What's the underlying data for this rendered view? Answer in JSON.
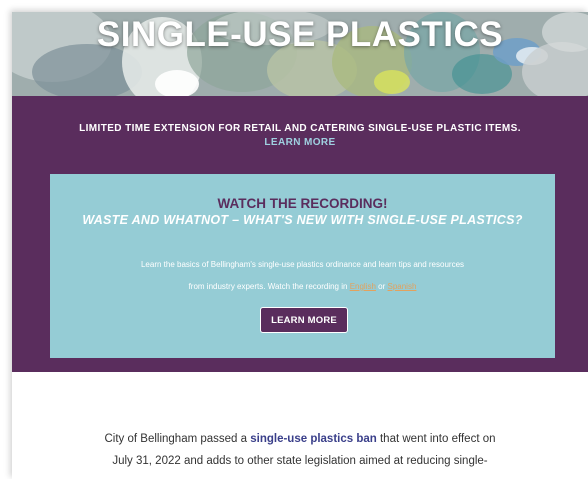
{
  "hero": {
    "title": "SINGLE-USE PLASTICS"
  },
  "notice": {
    "text": "LIMITED TIME EXTENSION FOR RETAIL AND CATERING SINGLE-USE PLASTIC ITEMS.",
    "link_label": "LEARN MORE"
  },
  "card": {
    "heading": "WATCH THE RECORDING!",
    "subheading": "WASTE AND WHATNOT – WHAT'S NEW WITH SINGLE-USE PLASTICS?",
    "body_line1": "Learn the basics of Bellingham's single-use plastics ordinance and learn tips and resources",
    "body_line2_prefix": "from industry experts.  Watch the recording in ",
    "english_link": "English",
    "or_text": " or ",
    "spanish_link": "Spanish",
    "button_label": "LEARN MORE"
  },
  "intro": {
    "line1_prefix": "City of Bellingham passed a ",
    "ban_link": "single-use plastics ban",
    "line1_suffix": " that went into effect on",
    "line2": "July 31, 2022 and adds to other state legislation aimed at reducing single-"
  },
  "colors": {
    "brand_purple": "#5a2d5d",
    "card_teal": "#95ccd5",
    "link_light_blue": "#9fd0e0",
    "link_orange": "#e2a25e",
    "link_navy": "#3a3f8a"
  }
}
